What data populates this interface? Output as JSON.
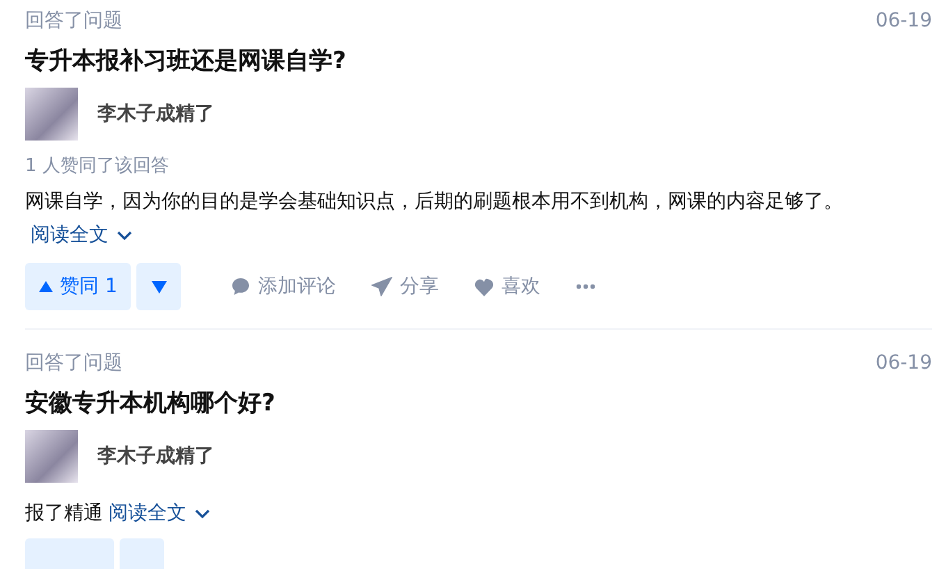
{
  "feed": [
    {
      "activity": "回答了问题",
      "date": "06-19",
      "question": "专升本报补习班还是网课自学?",
      "author": "李木子成精了",
      "vote_note": "1 人赞同了该回答",
      "excerpt": "网课自学，因为你的目的是学会基础知识点，后期的刷题根本用不到机构，网课的内容足够了。",
      "read_more": "阅读全文",
      "actions_cut": false,
      "upvote": "赞同 1",
      "comment": "添加评论",
      "share": "分享",
      "like": "喜欢"
    },
    {
      "activity": "回答了问题",
      "date": "06-19",
      "question": "安徽专升本机构哪个好?",
      "author": "李木子成精了",
      "excerpt": "报了精通",
      "read_more": "阅读全文",
      "actions_cut": true
    }
  ]
}
